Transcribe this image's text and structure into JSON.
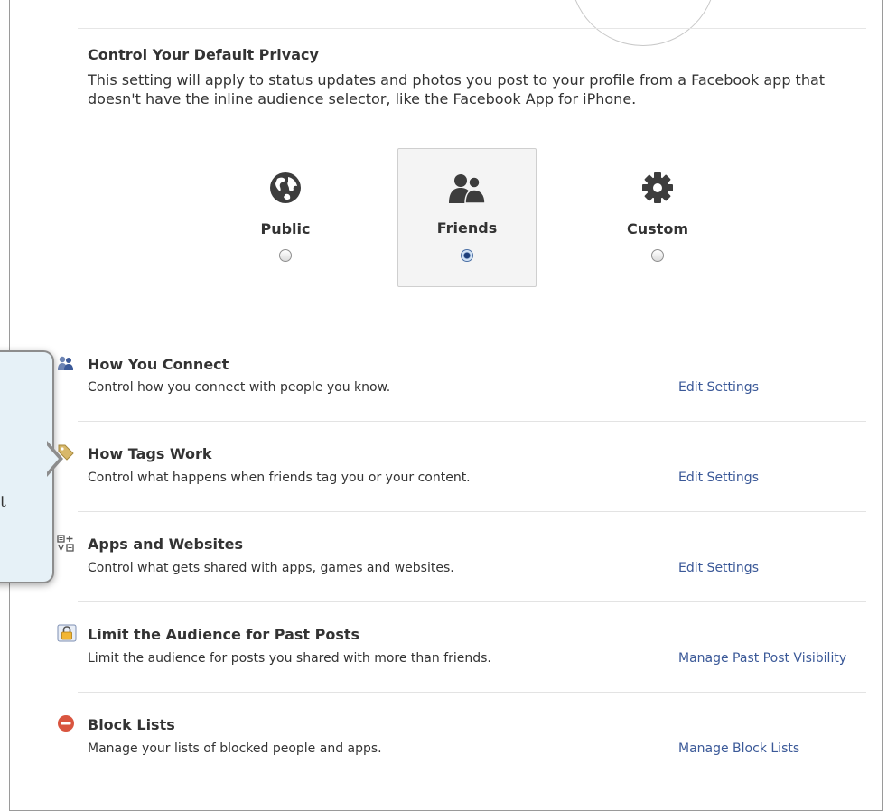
{
  "privacy": {
    "title": "Control Your Default Privacy",
    "description": "This setting will apply to status updates and photos you post to your profile from a Facebook app that doesn't have the inline audience selector, like the Facebook App for iPhone.",
    "options": [
      {
        "label": "Public",
        "icon": "globe-icon",
        "selected": false
      },
      {
        "label": "Friends",
        "icon": "friends-icon",
        "selected": true
      },
      {
        "label": "Custom",
        "icon": "gear-icon",
        "selected": false
      }
    ]
  },
  "callout": {
    "visible_text": "t"
  },
  "sections": [
    {
      "icon": "people-icon",
      "title": "How You Connect",
      "description": "Control how you connect with people you know.",
      "link": "Edit Settings"
    },
    {
      "icon": "tag-icon",
      "title": "How Tags Work",
      "description": "Control what happens when friends tag you or your content.",
      "link": "Edit Settings"
    },
    {
      "icon": "apps-icon",
      "title": "Apps and Websites",
      "description": "Control what gets shared with apps, games and websites.",
      "link": "Edit Settings"
    },
    {
      "icon": "lock-icon",
      "title": "Limit the Audience for Past Posts",
      "description": "Limit the audience for posts you shared with more than friends.",
      "link": "Manage Past Post Visibility"
    },
    {
      "icon": "block-icon",
      "title": "Block Lists",
      "description": "Manage your lists of blocked people and apps.",
      "link": "Manage Block Lists"
    }
  ],
  "colors": {
    "link": "#3b5998",
    "callout_bg": "#e6f1f7",
    "block_red": "#d9553f",
    "lock_yellow": "#f2b634"
  }
}
